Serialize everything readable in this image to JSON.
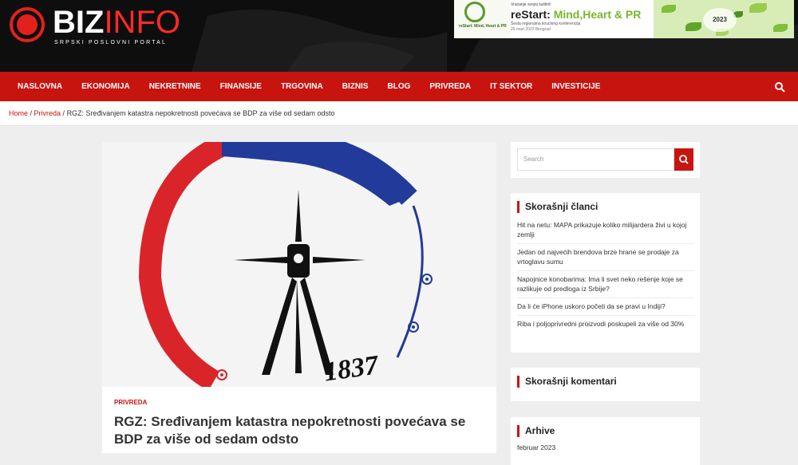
{
  "header": {
    "logo_main": "BIZ",
    "logo_accent": "INFO",
    "logo_tagline": "SRPSKI POSLOVNI PORTAL",
    "banner": {
      "tag": "Vraćanje svojoj suštini!",
      "title_prefix": "reStart: ",
      "title_highlight": "Mind,Heart & PR",
      "description": "Šesta regionalna kouching konferencija",
      "date": "26 mart 2023 Beograd",
      "left_label": "reStart: Mind, Heart & PR",
      "year": "2023"
    }
  },
  "nav": {
    "items": [
      "NASLOVNA",
      "EKONOMIJA",
      "NEKRETNINE",
      "FINANSIJE",
      "TRGOVINA",
      "BIZNIS",
      "BLOG",
      "PRIVREDA",
      "IT SEKTOR",
      "INVESTICIJE"
    ],
    "search_icon": "search-icon"
  },
  "breadcrumb": {
    "home": "Home",
    "section": "Privreda",
    "current": "RGZ: Sređivanjem katastra nepokretnosti povećava se BDP za više od sedam odsto"
  },
  "article": {
    "category": "PRIVREDA",
    "title": "RGZ: Sređivanjem katastra nepokretnosti povećava se BDP za više od sedam odsto",
    "image_year": "1837"
  },
  "sidebar": {
    "search_placeholder": "Search",
    "recent_title": "Skorašnji članci",
    "recent": [
      "Hit na netu: MAPA prikazuje koliko milijardera živi u kojoj zemlji",
      "Jedan od najvećih brendova brze hrane se prodaje za vrtoglavu sumu",
      "Napojnice konobarima: Ima li svet neko rešenje koje se razlikuje od predloga iz Srbije?",
      "Da li će iPhone uskoro početi da se pravi u Indiji?",
      "Riba i poljoprivredni proizvodi poskupeli za više od 30%"
    ],
    "comments_title": "Skorašnji komentari",
    "archive_title": "Arhive",
    "archive_items": [
      "februar 2023"
    ]
  },
  "colors": {
    "brand_red": "#c8140f",
    "header_bg": "#0e0e0e"
  }
}
